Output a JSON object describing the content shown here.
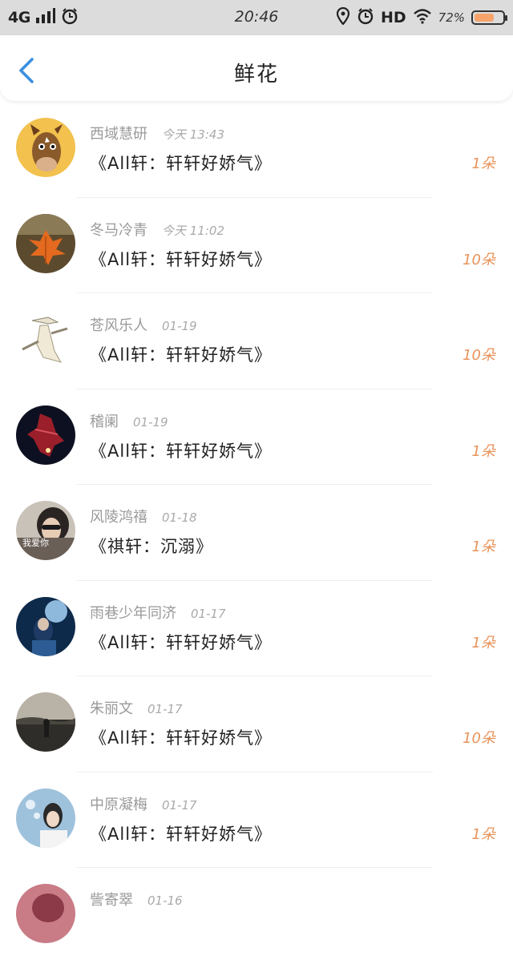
{
  "status_bar": {
    "network": "4G",
    "time": "20:46",
    "hd": "HD",
    "battery": "72%",
    "battery_level": 0.72
  },
  "header": {
    "title": "鲜花"
  },
  "entries": [
    {
      "name": "西域慧研",
      "date": "今天 13:43",
      "gift": "《All轩：轩轩好娇气》",
      "count": "1朵"
    },
    {
      "name": "冬马冷青",
      "date": "今天 11:02",
      "gift": "《All轩：轩轩好娇气》",
      "count": "10朵"
    },
    {
      "name": "苍风乐人",
      "date": "01-19",
      "gift": "《All轩：轩轩好娇气》",
      "count": "10朵"
    },
    {
      "name": "稽阑",
      "date": "01-19",
      "gift": "《All轩：轩轩好娇气》",
      "count": "1朵"
    },
    {
      "name": "风陵鸿禧",
      "date": "01-18",
      "gift": "《祺轩：沉溺》",
      "count": "1朵"
    },
    {
      "name": "雨巷少年同济",
      "date": "01-17",
      "gift": "《All轩：轩轩好娇气》",
      "count": "1朵"
    },
    {
      "name": "朱丽文",
      "date": "01-17",
      "gift": "《All轩：轩轩好娇气》",
      "count": "10朵"
    },
    {
      "name": "中原凝梅",
      "date": "01-17",
      "gift": "《All轩：轩轩好娇气》",
      "count": "1朵"
    },
    {
      "name": "訾寄翠",
      "date": "01-16",
      "gift": "",
      "count": ""
    }
  ],
  "avatar_badge_text": "我爱你",
  "colors": {
    "accent": "#3b8fe0",
    "count": "#e8935a",
    "status_bar_bg": "#dcdcdc",
    "battery_fill": "#f6a46b"
  },
  "icons": {
    "signal": "signal-bars-icon",
    "alarm": "alarm-icon",
    "location": "location-pin-icon",
    "wifi": "wifi-icon",
    "back": "chevron-left-icon"
  }
}
